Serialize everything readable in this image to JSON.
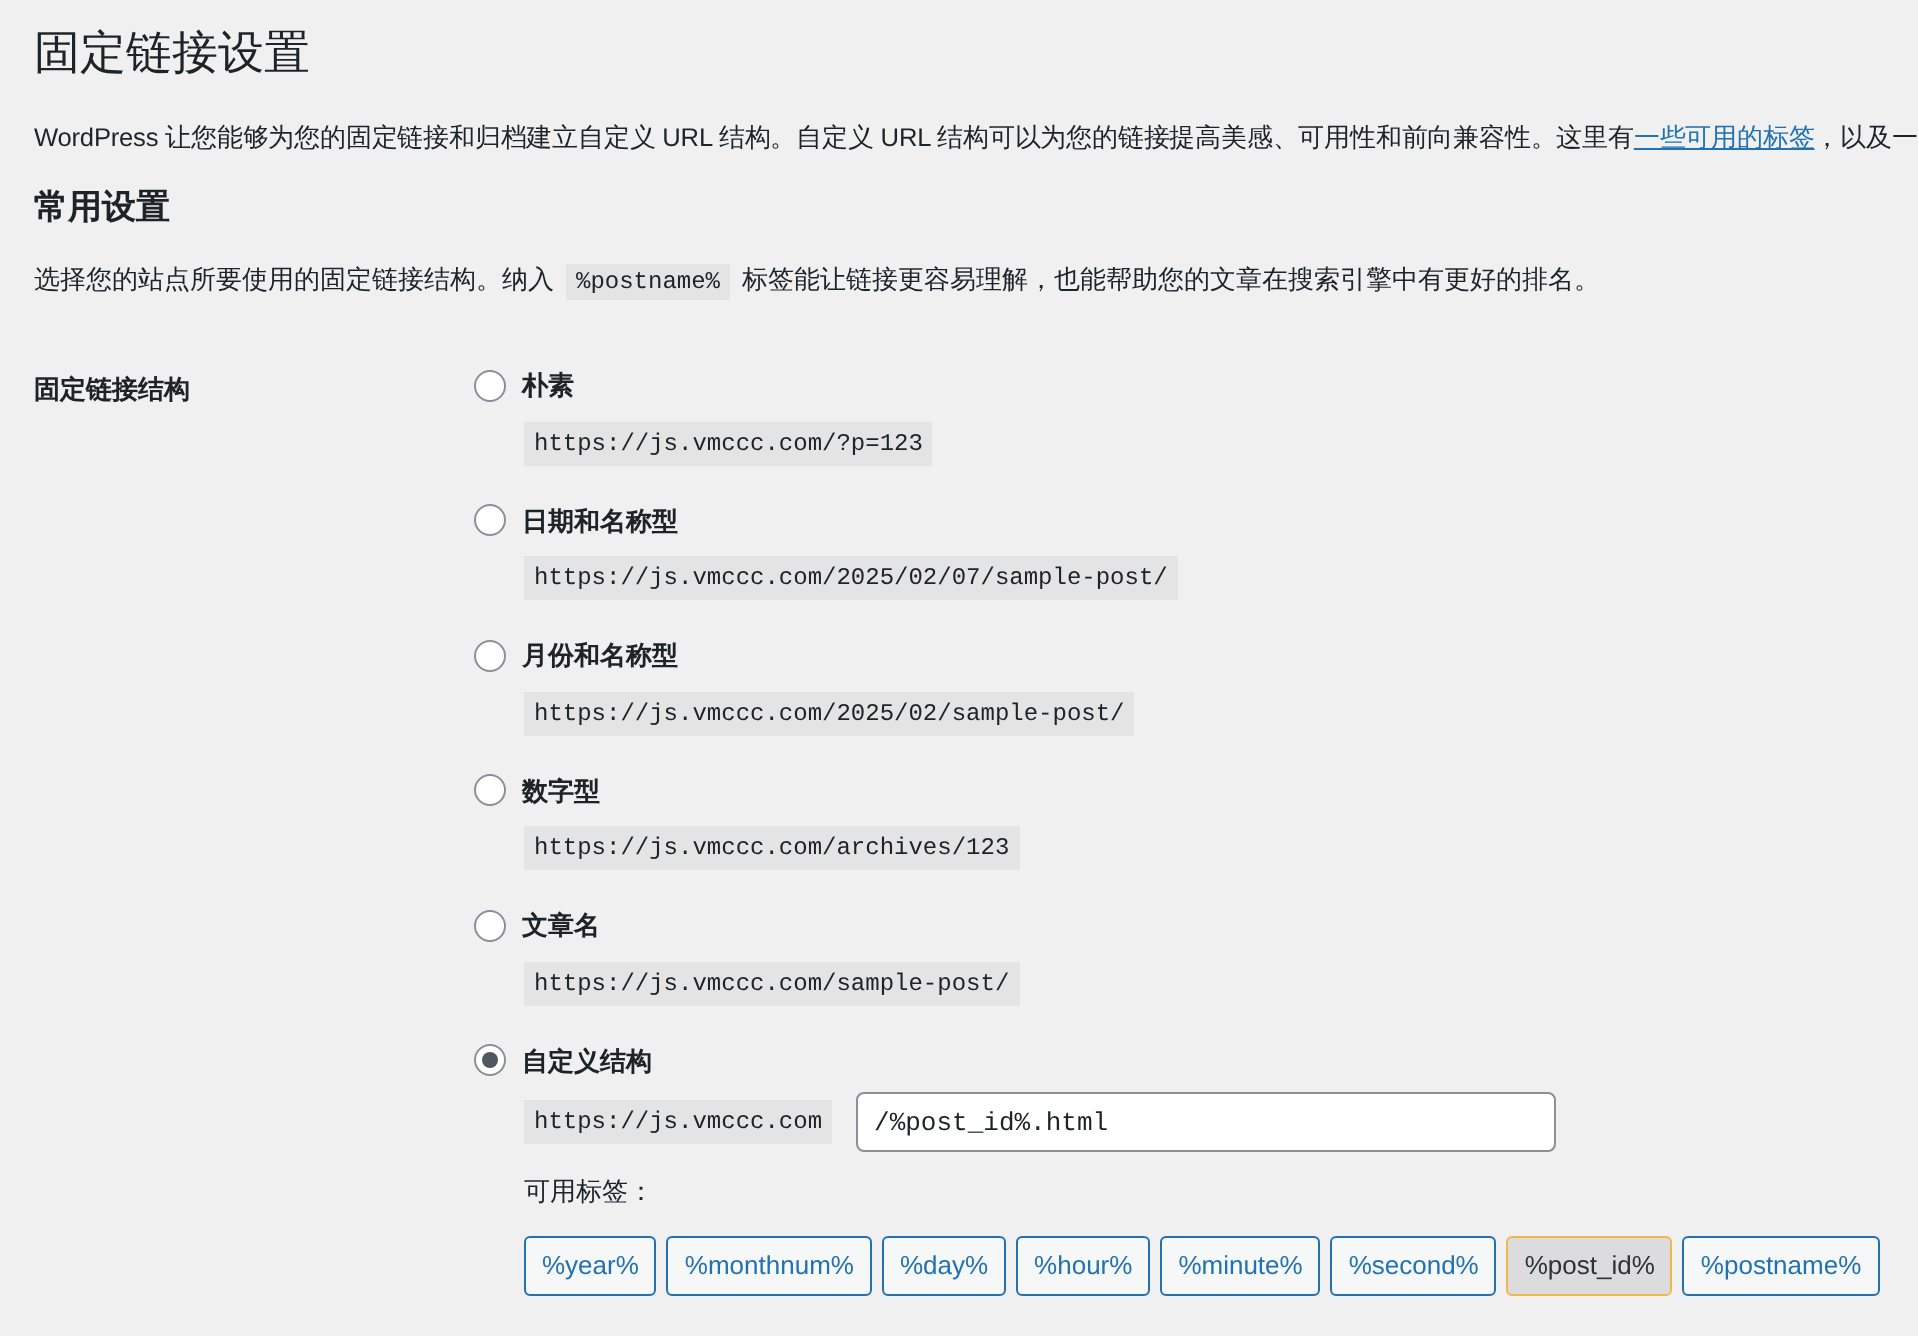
{
  "title": "固定链接设置",
  "intro": {
    "before": "WordPress 让您能够为您的固定链接和归档建立自定义 URL 结构。自定义 URL 结构可以为您的链接提高美感、可用性和前向兼容性。这里有",
    "link": "一些可用的标签",
    "after": "，以及一"
  },
  "section_title": "常用设置",
  "section_desc": {
    "before": "选择您的站点所要使用的固定链接结构。纳入",
    "code": "%postname%",
    "after": "标签能让链接更容易理解，也能帮助您的文章在搜索引擎中有更好的排名。"
  },
  "field_label": "固定链接结构",
  "options": [
    {
      "kind": "preset",
      "label": "朴素",
      "example": "https://js.vmccc.com/?p=123",
      "selected": false
    },
    {
      "kind": "preset",
      "label": "日期和名称型",
      "example": "https://js.vmccc.com/2025/02/07/sample-post/",
      "selected": false
    },
    {
      "kind": "preset",
      "label": "月份和名称型",
      "example": "https://js.vmccc.com/2025/02/sample-post/",
      "selected": false
    },
    {
      "kind": "preset",
      "label": "数字型",
      "example": "https://js.vmccc.com/archives/123",
      "selected": false
    },
    {
      "kind": "preset",
      "label": "文章名",
      "example": "https://js.vmccc.com/sample-post/",
      "selected": false
    },
    {
      "kind": "custom",
      "label": "自定义结构",
      "prefix": "https://js.vmccc.com",
      "value": "/%post_id%.html",
      "selected": true
    }
  ],
  "tags_label": "可用标签：",
  "tags": [
    {
      "label": "%year%",
      "selected": false
    },
    {
      "label": "%monthnum%",
      "selected": false
    },
    {
      "label": "%day%",
      "selected": false
    },
    {
      "label": "%hour%",
      "selected": false
    },
    {
      "label": "%minute%",
      "selected": false
    },
    {
      "label": "%second%",
      "selected": false
    },
    {
      "label": "%post_id%",
      "selected": true
    },
    {
      "label": "%postname%",
      "selected": false
    }
  ]
}
